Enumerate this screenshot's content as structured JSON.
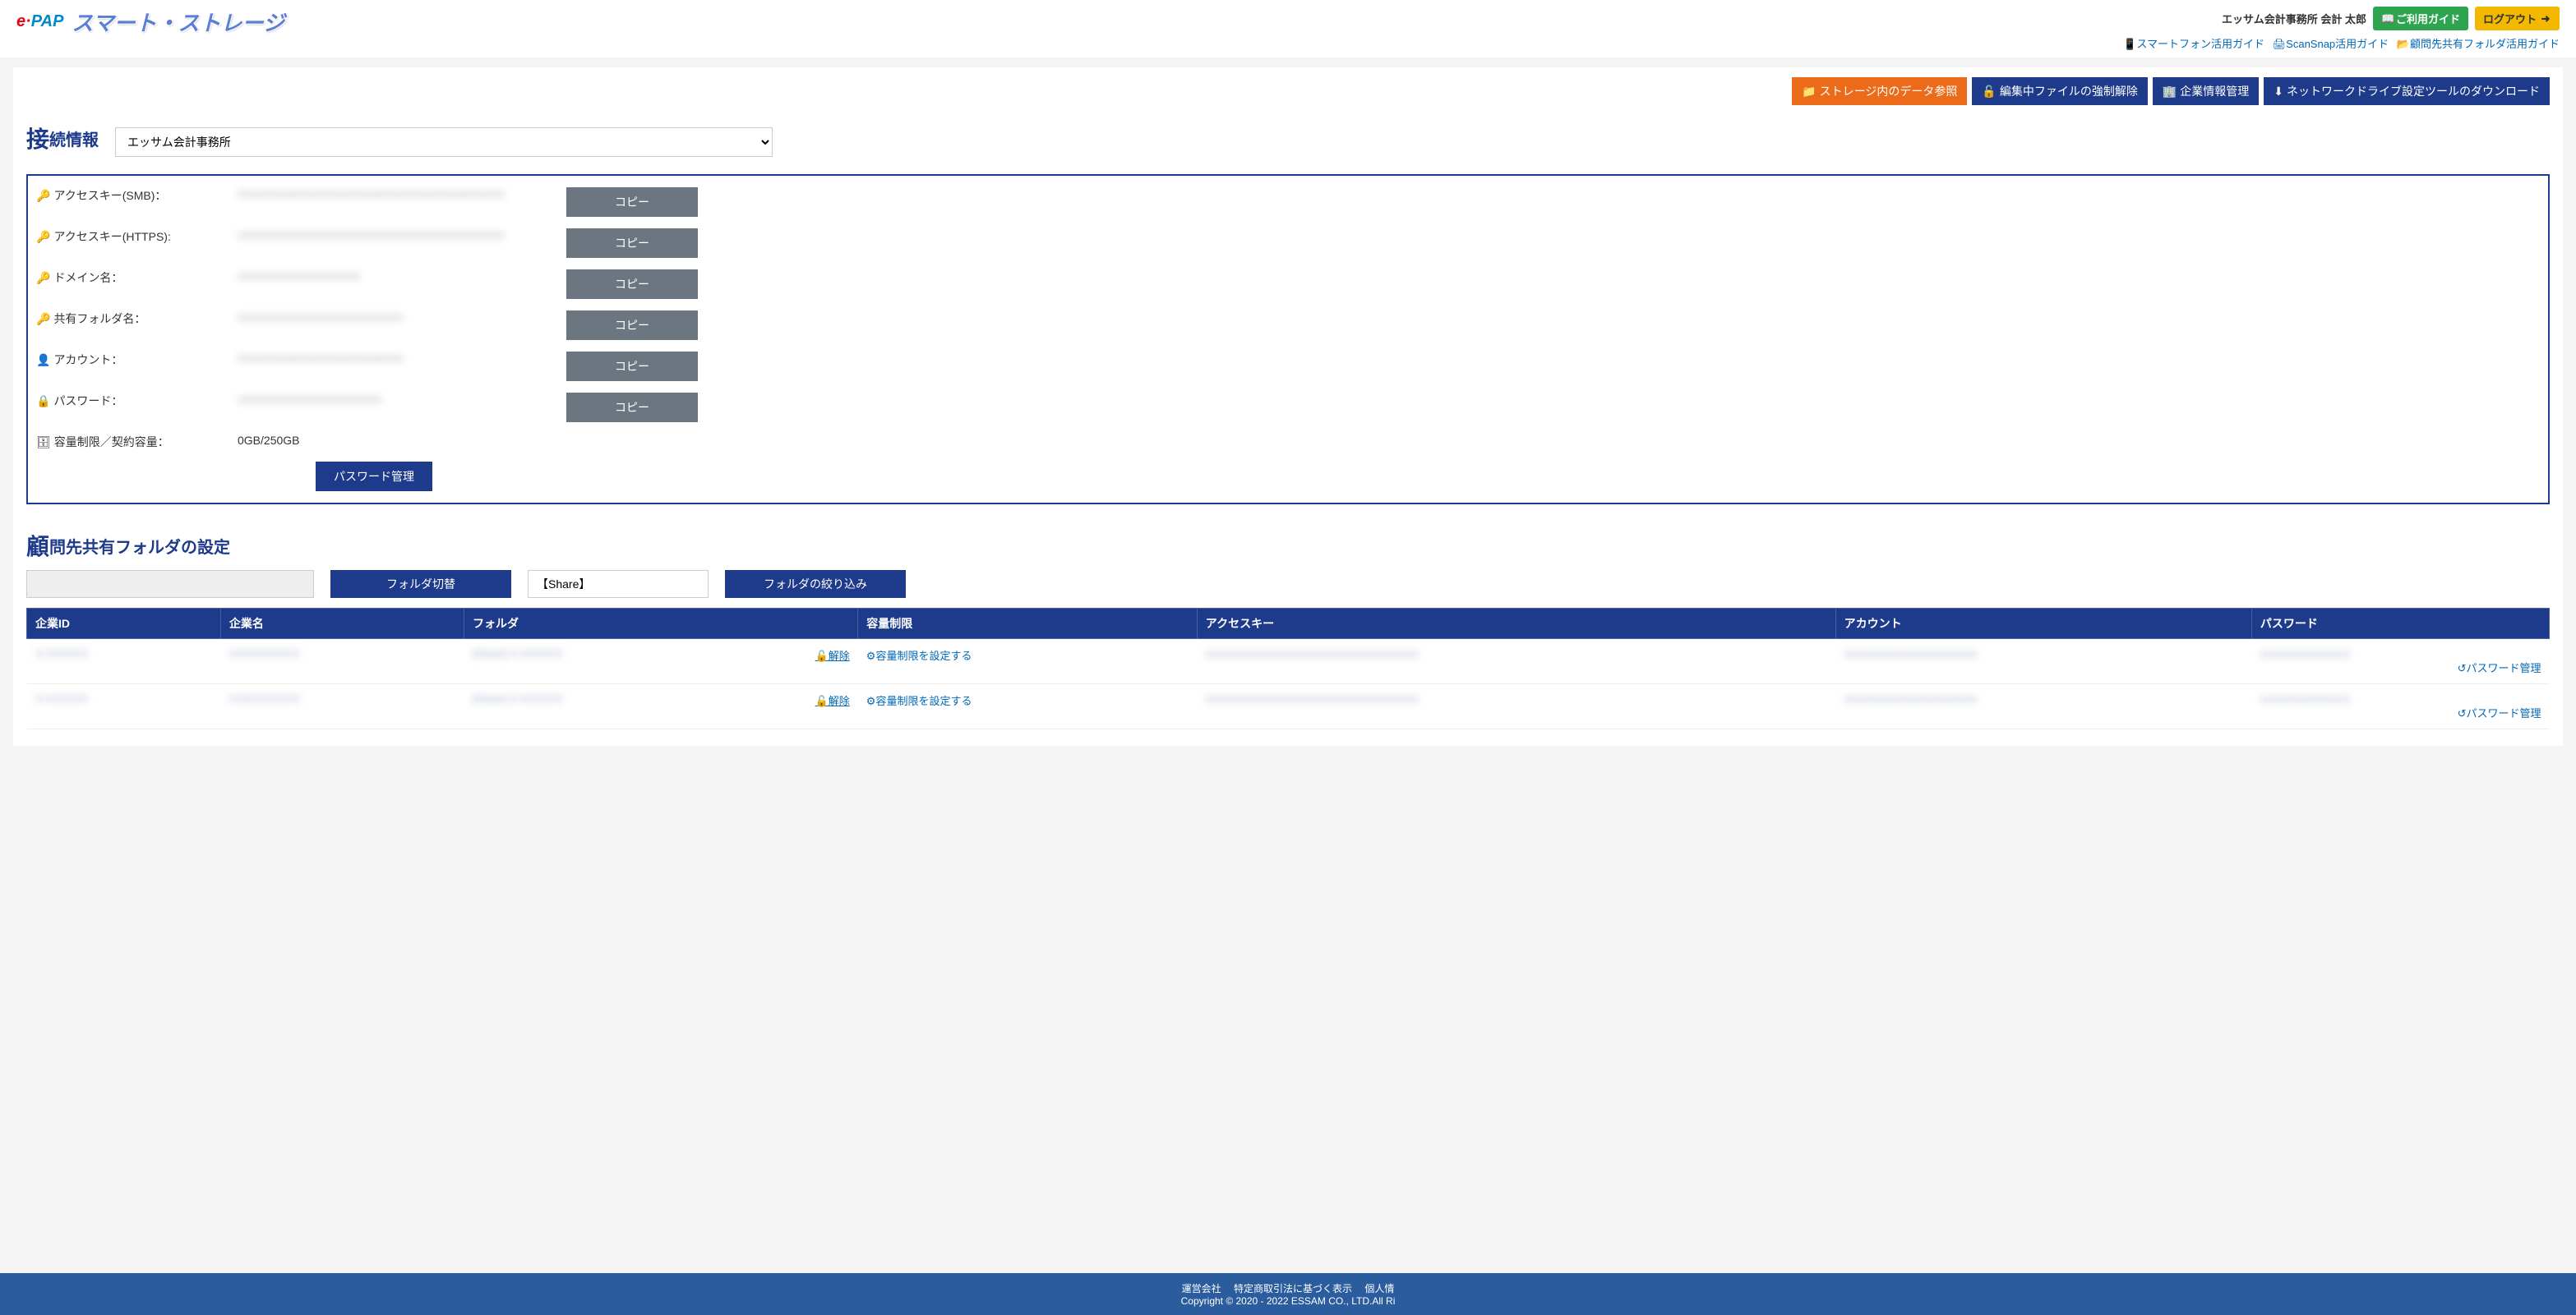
{
  "header": {
    "logo_e": "e·",
    "logo_pap": "PAP",
    "logo_title": "スマート・ストレージ",
    "user_name": "エッサム会計事務所 会計 太郎",
    "guide_btn": "ご利用ガイド",
    "logout_btn": "ログアウト",
    "links": {
      "smartphone": "スマートフォン活用ガイド",
      "scansnap": "ScanSnap活用ガイド",
      "shared": "顧問先共有フォルダ活用ガイド"
    }
  },
  "toolbar": {
    "storage_browse": "ストレージ内のデータ参照",
    "force_unlock": "編集中ファイルの強制解除",
    "company_mgmt": "企業情報管理",
    "network_tool": "ネットワークドライブ設定ツールのダウンロード"
  },
  "connection": {
    "title_big": "接",
    "title_rest": "続情報",
    "select_value": "エッサム会計事務所",
    "labels": {
      "smb": "アクセスキー(SMB)：",
      "https": "アクセスキー(HTTPS):",
      "domain": "ドメイン名：",
      "shared_folder": "共有フォルダ名：",
      "account": "アカウント：",
      "password": "パスワード：",
      "capacity": "容量制限／契約容量："
    },
    "values": {
      "smb": "xxxxxxxxxxxxxxxxxxxxxxxxxxxxxxxxxxxxxxxxxxxxxxxxxx",
      "https": "xxxxxxxxxxxxxxxxxxxxxxxxxxxxxxxxxxxxxxxxxxxxxxxxxx",
      "domain": "xxxxxxxxxxxxxxxxxxxxxxx",
      "shared_folder": "xxxxxxxxxxxxxxxxxxxxxxxxxxxxxxx",
      "account": "xxxxxxxxxxxxxxxxxxxxxxxxxxxxxxx",
      "password": "xxxxxxxxxxxxxxxxxxxxxxxxxxx",
      "capacity": "0GB/250GB"
    },
    "copy_btn": "コピー",
    "pw_mgmt_btn": "パスワード管理"
  },
  "folders": {
    "title_big": "顧",
    "title_rest": "問先共有フォルダの設定",
    "switch_btn": "フォルダ切替",
    "share_value": "【Share】",
    "filter_btn": "フォルダの絞り込み",
    "headers": {
      "company_id": "企業ID",
      "company_name": "企業名",
      "folder": "フォルダ",
      "capacity": "容量制限",
      "access_key": "アクセスキー",
      "account": "アカウント",
      "password": "パスワード"
    },
    "rows": [
      {
        "company_id": "X-XXXXXX",
        "company_name": "XXXXXXXXXX",
        "folder": "[Share] X-XXXXXX",
        "release": "解除",
        "capacity_link": "容量制限を設定する",
        "access_key": "xxxxxxxxxxxxxxxxxxxxxxxxxxxxxxxxxxxxxxxx",
        "account": "xxxxxxxxxxxxxxxxxxxxxxxxx",
        "password": "xxxxxxxxxxxxxxxxx",
        "pw_link": "パスワード管理"
      },
      {
        "company_id": "X-XXXXXX",
        "company_name": "XXXXXXXXXX",
        "folder": "[Share] X-XXXXXX",
        "release": "解除",
        "capacity_link": "容量制限を設定する",
        "access_key": "xxxxxxxxxxxxxxxxxxxxxxxxxxxxxxxxxxxxxxxx",
        "account": "xxxxxxxxxxxxxxxxxxxxxxxxx",
        "password": "xxxxxxxxxxxxxxxxx",
        "pw_link": "パスワード管理"
      }
    ]
  },
  "footer": {
    "links": {
      "operator": "運営会社",
      "commerce": "特定商取引法に基づく表示",
      "privacy": "個人情"
    },
    "copyright": "Copyright © 2020 - 2022 ESSAM CO., LTD.All Ri"
  },
  "icons": {
    "book": "📘",
    "logout": "↪",
    "phone": "📱",
    "print": "🖨",
    "share": "📂",
    "folder": "📁",
    "unlock": "🔓",
    "building": "🏢",
    "download": "⬇",
    "key": "🔑",
    "user": "👤",
    "lock": "🔒",
    "db": "🗄",
    "gear": "⚙",
    "undo": "↺"
  }
}
